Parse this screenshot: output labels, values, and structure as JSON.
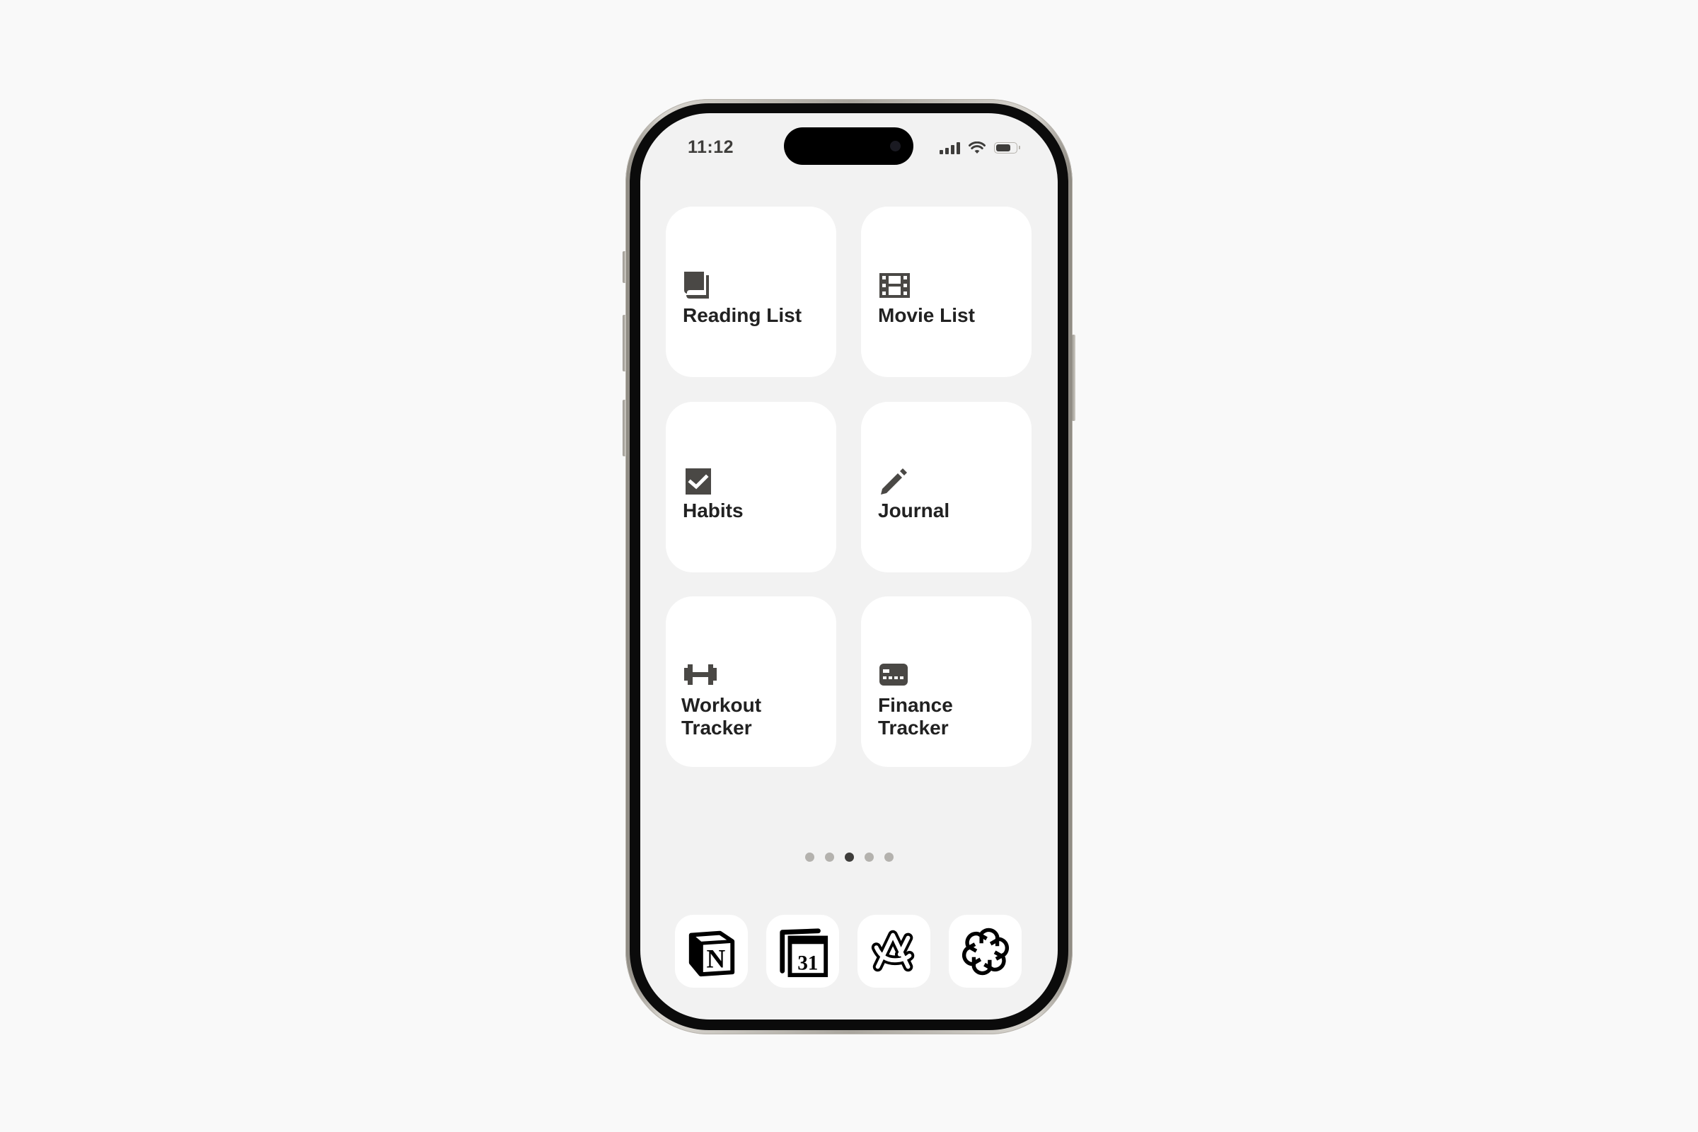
{
  "status_bar": {
    "time": "11:12",
    "signal_bars": 4,
    "wifi": "full",
    "battery_level_percent": 75
  },
  "widgets": [
    {
      "label": "Reading List",
      "icon": "book-icon"
    },
    {
      "label": "Movie List",
      "icon": "film-icon"
    },
    {
      "label": "Habits",
      "icon": "checkbox-icon"
    },
    {
      "label": "Journal",
      "icon": "pencil-icon"
    },
    {
      "label": "Workout Tracker",
      "icon": "dumbbell-icon"
    },
    {
      "label": "Finance Tracker",
      "icon": "credit-card-icon"
    }
  ],
  "page_indicator": {
    "count": 5,
    "active_index": 2
  },
  "dock": [
    {
      "name": "Notion",
      "icon": "notion-icon"
    },
    {
      "name": "Notion Calendar",
      "icon": "calendar-31-icon"
    },
    {
      "name": "Arc",
      "icon": "arc-icon"
    },
    {
      "name": "ChatGPT",
      "icon": "chatgpt-icon"
    }
  ],
  "colors": {
    "page_background": "#f9f9f9",
    "screen_background": "#f2f2f2",
    "widget_background": "#ffffff",
    "icon_color": "#4a4845",
    "label_color": "#212121",
    "dot_inactive": "#b4b2ae",
    "dot_active": "#3e3d3b"
  }
}
